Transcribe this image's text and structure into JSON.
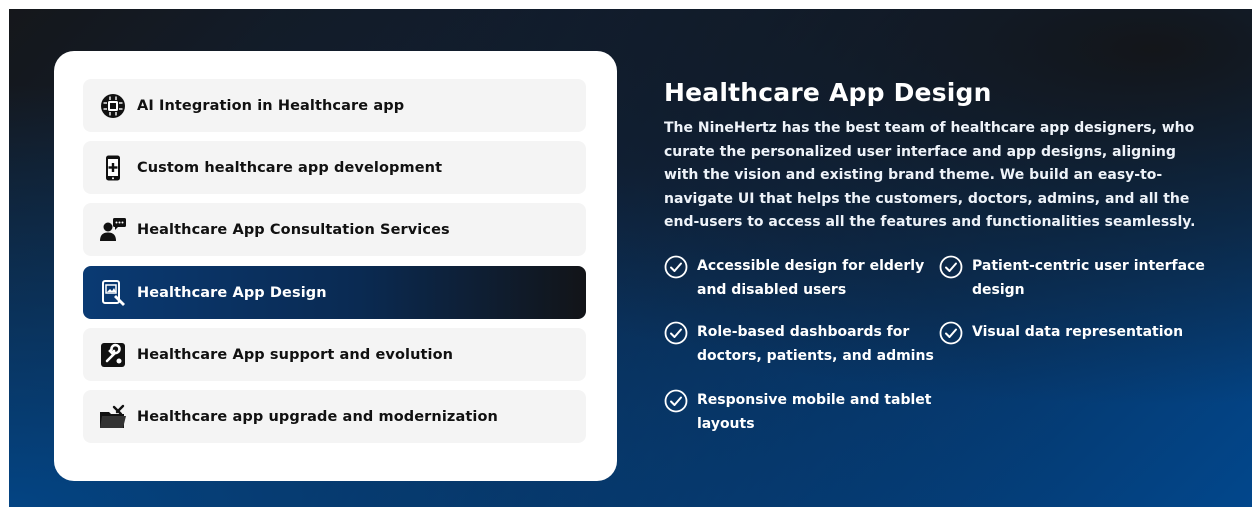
{
  "services": [
    {
      "label": "AI Integration in Healthcare app",
      "icon": "ai-chip-icon"
    },
    {
      "label": "Custom healthcare app development",
      "icon": "mobile-medical-icon"
    },
    {
      "label": "Healthcare App Consultation Services",
      "icon": "consultation-icon"
    },
    {
      "label": "Healthcare App Design",
      "icon": "design-tablet-icon"
    },
    {
      "label": "Healthcare App support and evolution",
      "icon": "wrench-support-icon"
    },
    {
      "label": "Healthcare app upgrade and modernization",
      "icon": "folder-tools-icon"
    }
  ],
  "active_index": 3,
  "detail": {
    "title": "Healthcare App Design",
    "description": "The NineHertz has the best team of healthcare app designers, who curate the personalized user interface and app designs, aligning with the vision and existing brand theme. We build an easy-to-navigate UI that helps the customers, doctors, admins, and all the end-users to access all the features and functionalities seamlessly.",
    "features": [
      {
        "line1": "Accessible design for elderly",
        "line2": "and disabled users"
      },
      {
        "line1": "Patient-centric user interface",
        "line2": "design"
      },
      {
        "line1": "Role-based dashboards for",
        "line2": "doctors, patients, and admins"
      },
      {
        "line1": "Visual data representation",
        "line2": ""
      },
      {
        "line1": "Responsive mobile and tablet",
        "line2": "layouts"
      }
    ]
  },
  "colors": {
    "accent_dark": "#0a2a52",
    "accent_blue": "#02478c",
    "card_bg": "#ffffff",
    "item_bg": "#f4f4f4"
  }
}
